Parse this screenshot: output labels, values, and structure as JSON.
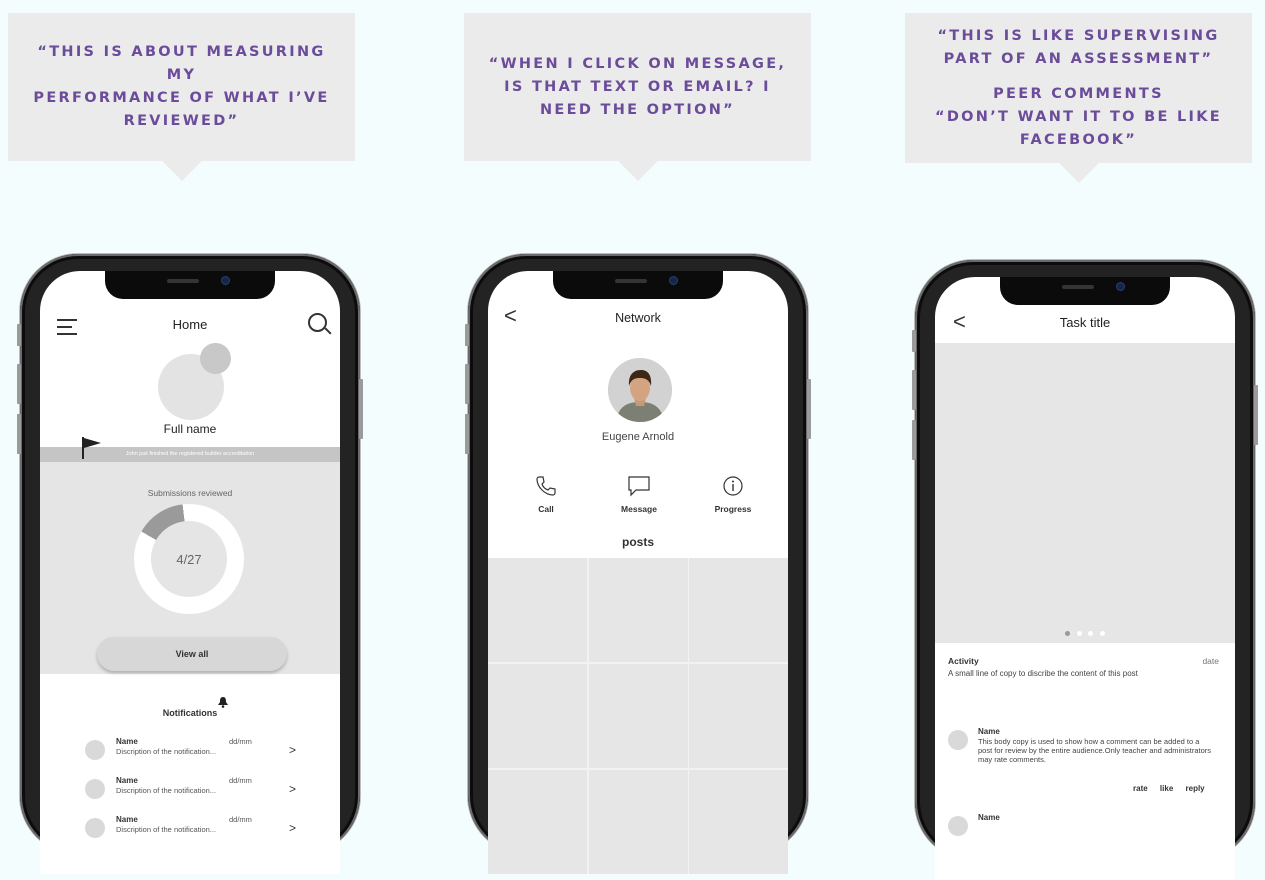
{
  "quotes": {
    "q1": [
      "“THIS IS ABOUT MEASURING MY",
      "PERFORMANCE OF WHAT I’VE",
      "REVIEWED”"
    ],
    "q2": [
      "“WHEN I CLICK ON MESSAGE,",
      "IS THAT TEXT OR EMAIL? I",
      "NEED THE OPTION”"
    ],
    "q3a": [
      "“THIS IS LIKE SUPERVISING",
      "PART OF AN ASSESSMENT”"
    ],
    "q3b": [
      "PEER COMMENTS",
      "“DON’T WANT IT TO BE LIKE",
      "FACEBOOK”"
    ]
  },
  "home": {
    "title": "Home",
    "full_name": "Full name",
    "activity": "John just finished the registered builder accreditation",
    "submissions_label": "Submissions reviewed",
    "progress_text": "4/27",
    "progress_fraction": 0.148,
    "view_all": "View all",
    "notifications_title": "Notifications",
    "notifications": [
      {
        "name": "Name",
        "desc": "Discription of the notification...",
        "date": "dd/mm",
        "chevron": ">"
      },
      {
        "name": "Name",
        "desc": "Discription of the notification...",
        "date": "dd/mm",
        "chevron": ">"
      },
      {
        "name": "Name",
        "desc": "Discription of the notification...",
        "date": "dd/mm",
        "chevron": ">"
      }
    ]
  },
  "network": {
    "title": "Network",
    "back": "<",
    "person_name": "Eugene Arnold",
    "actions": [
      {
        "label": "Call",
        "icon": "phone-icon"
      },
      {
        "label": "Message",
        "icon": "message-icon"
      },
      {
        "label": "Progress",
        "icon": "info-icon"
      }
    ],
    "posts_title": "posts"
  },
  "task": {
    "title": "Task title",
    "back": "<",
    "activity_label": "Activity",
    "activity_date": "date",
    "activity_copy": "A small line of copy to discribe the content of this post",
    "comments": [
      {
        "name": "Name",
        "body": "This body copy is used to show how a comment can be added to a post for review by the entire audience.Only teacher and administrators may rate comments.",
        "rate": "rate",
        "like": "like",
        "reply": "reply"
      },
      {
        "name": "Name",
        "body": ""
      }
    ]
  },
  "colors": {
    "quote_text": "#6b4c9a",
    "bubble": "#ebebeb",
    "page": "#f4fdfd"
  }
}
